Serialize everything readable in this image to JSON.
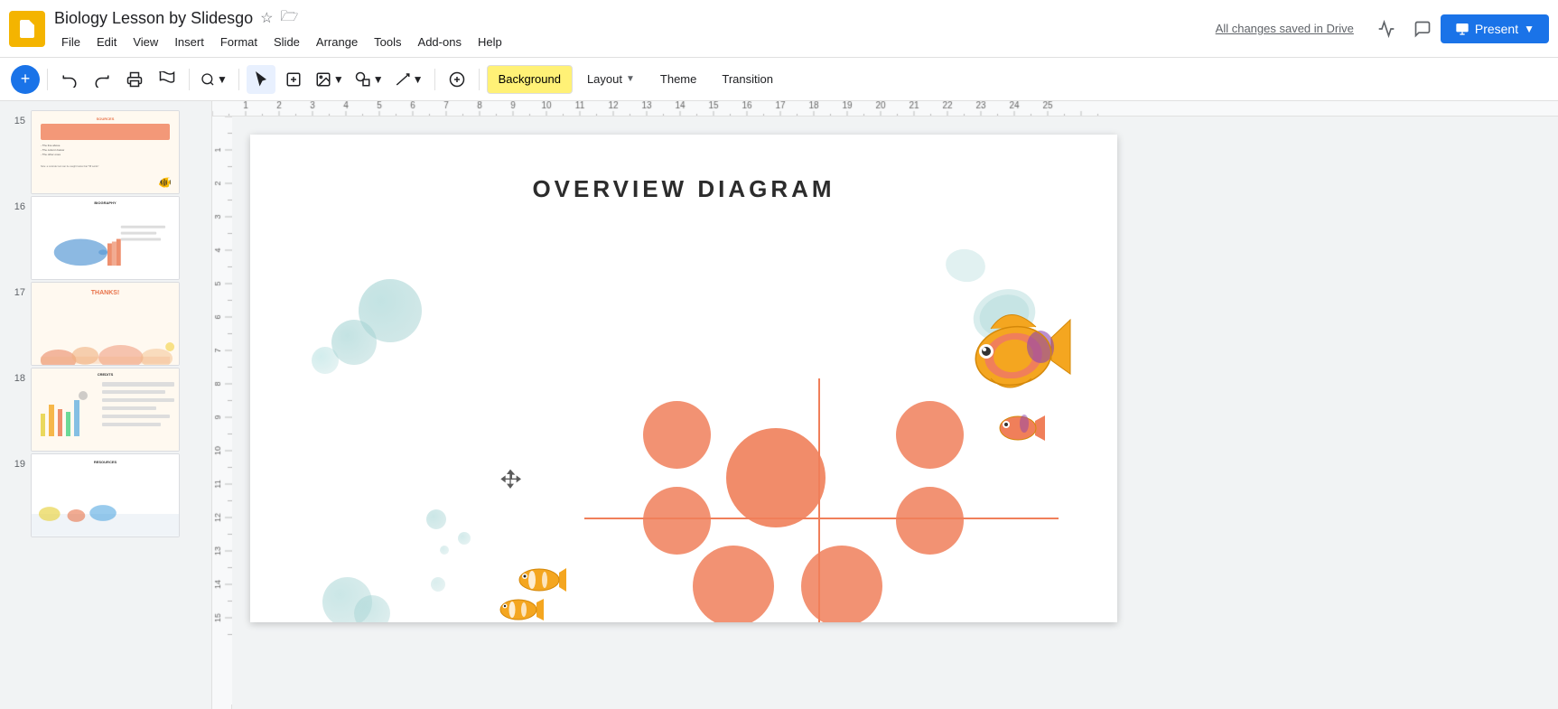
{
  "app": {
    "icon_color": "#f4b400",
    "title": "Biology Lesson by Slidesgo",
    "save_status": "All changes saved in Drive"
  },
  "menu": {
    "items": [
      "File",
      "Edit",
      "View",
      "Insert",
      "Format",
      "Slide",
      "Arrange",
      "Tools",
      "Add-ons",
      "Help"
    ]
  },
  "toolbar": {
    "background_label": "Background",
    "layout_label": "Layout",
    "theme_label": "Theme",
    "transition_label": "Transition"
  },
  "present_btn": "Present",
  "slides": [
    {
      "num": "15",
      "active": false
    },
    {
      "num": "16",
      "active": false
    },
    {
      "num": "17",
      "active": false
    },
    {
      "num": "18",
      "active": false
    },
    {
      "num": "19",
      "active": false
    }
  ],
  "current_slide": {
    "title": "OVERVIEW DIAGRAM"
  },
  "ruler": {
    "numbers": [
      "1",
      "2",
      "3",
      "4",
      "5",
      "6",
      "7",
      "8",
      "9",
      "10",
      "11",
      "12",
      "13",
      "14",
      "15",
      "16",
      "17",
      "18",
      "19",
      "20",
      "21",
      "22",
      "23",
      "24",
      "25"
    ]
  }
}
